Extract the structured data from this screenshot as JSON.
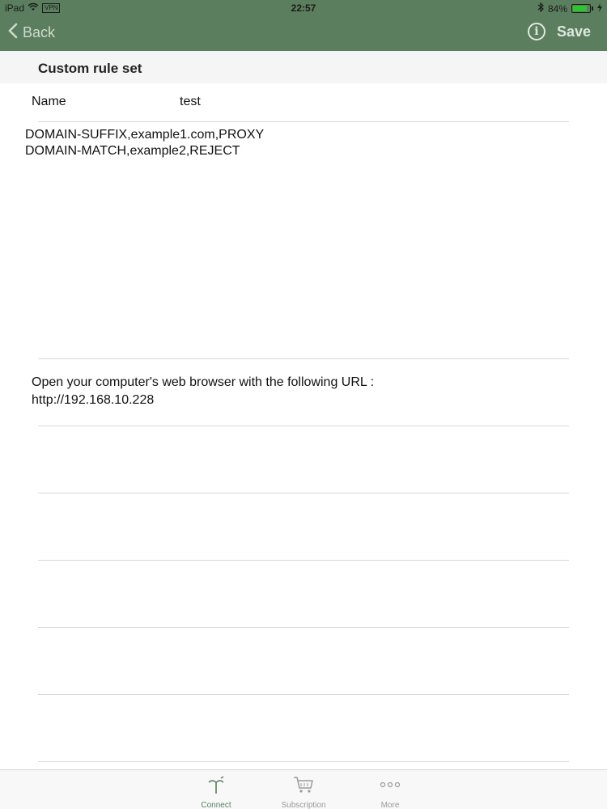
{
  "status_bar": {
    "device": "iPad",
    "vpn": "VPN",
    "time": "22:57",
    "battery": "84%",
    "battery_level": 0.84
  },
  "nav": {
    "back_label": "Back",
    "save_label": "Save"
  },
  "section": {
    "title": "Custom rule set"
  },
  "form": {
    "name_label": "Name",
    "name_value": "test",
    "rules_text": "DOMAIN-SUFFIX,example1.com,PROXY\nDOMAIN-MATCH,example2,REJECT"
  },
  "url_info": {
    "line1": "Open your computer's web browser with the following URL :",
    "line2": "http://192.168.10.228"
  },
  "tabbar": {
    "items": [
      {
        "label": "Connect",
        "icon": "antenna-icon",
        "active": true
      },
      {
        "label": "Subscription",
        "icon": "cart-icon",
        "active": false
      },
      {
        "label": "More",
        "icon": "more-dots-icon",
        "active": false
      }
    ]
  },
  "colors": {
    "nav_background": "#5a7e5e",
    "active_tab": "#5a7e5e",
    "inactive_tab": "#9a9a9a"
  }
}
